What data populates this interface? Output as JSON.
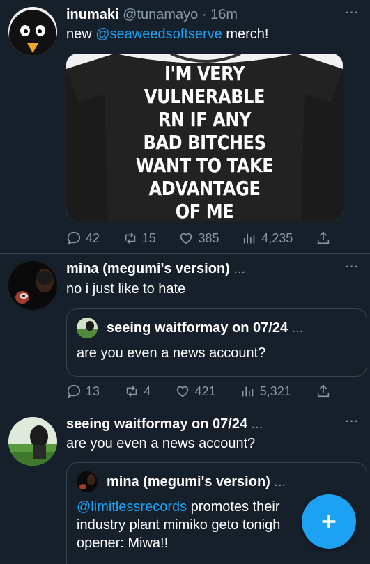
{
  "tweets": [
    {
      "author_name": "inumaki",
      "handle": "@tunamayo",
      "separator": "·",
      "time": "16m",
      "text_before": "new ",
      "mention": "@seaweedsoftserve",
      "text_after": " merch!",
      "media_text": "I'M VERY VULNERABLE RN IF ANY BAD BITCHES WANT TO TAKE ADVANTAGE OF ME",
      "media_lines": [
        "I'M VERY",
        "VULNERABLE",
        "RN IF ANY",
        "BAD BITCHES",
        "WANT TO TAKE",
        "ADVANTAGE",
        "OF ME"
      ],
      "replies": "42",
      "retweets": "15",
      "likes": "385",
      "views": "4,235"
    },
    {
      "author_name": "mina (megumi's version)",
      "ellipsis": "...",
      "text": "no i just like to hate",
      "quote_author": "seeing waitformay on 07/24",
      "quote_ellipsis": "...",
      "quote_text": "are you even a news account?",
      "replies": "13",
      "retweets": "4",
      "likes": "421",
      "views": "5,321"
    },
    {
      "author_name": "seeing waitformay on 07/24",
      "ellipsis": "...",
      "text": "are you even a news account?",
      "quote_author": "mina (megumi's version)",
      "quote_ellipsis": "...",
      "quote_mention": "@limitlessrecords",
      "quote_text_line1_rest": " promotes their",
      "quote_text_line2": "industry plant mimiko geto tonigh",
      "quote_text_line3": "opener: Miwa!!"
    }
  ],
  "more_icon": "···",
  "colors": {
    "background": "#15202b",
    "accent": "#1da1f2",
    "muted": "#8899a6",
    "divider": "#38444d"
  }
}
